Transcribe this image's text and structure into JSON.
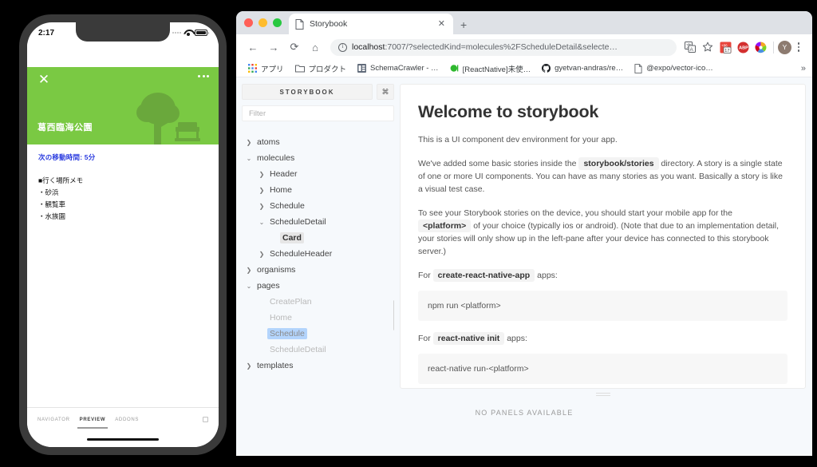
{
  "phone": {
    "status": {
      "time": "2:17",
      "signal_icon": "signal-dots-icon",
      "wifi_icon": "wifi-icon",
      "battery_icon": "battery-icon"
    },
    "card": {
      "close_icon": "close-icon",
      "more_icon": "more-horizontal-icon",
      "title": "葛西臨海公園",
      "art_icon": "park-tree-bench-icon",
      "bg_color": "#7ac943"
    },
    "detail": {
      "next_move": "次の移動時間: 5分",
      "next_move_color": "#2a3bdf",
      "memo_heading": "■行く場所メモ",
      "memo_items": [
        "・砂浜",
        "・観覧車",
        "・水族園"
      ]
    },
    "tabbar": {
      "tabs": [
        {
          "label": "NAVIGATOR",
          "active": false
        },
        {
          "label": "PREVIEW",
          "active": true
        },
        {
          "label": "ADDONS",
          "active": false
        }
      ],
      "addon_toggle_icon": "square-outline-icon"
    }
  },
  "browser": {
    "window_controls": {
      "close": "close-traffic-light",
      "minimize": "minimize-traffic-light",
      "zoom": "zoom-traffic-light"
    },
    "tab": {
      "title": "Storybook",
      "favicon": "page-icon",
      "close_label": "✕"
    },
    "new_tab_label": "+",
    "toolbar": {
      "back_label": "←",
      "forward_label": "→",
      "reload_label": "⟳",
      "home_label": "⌂",
      "url_host": "localhost",
      "url_rest": ":7007/?selectedKind=molecules%2FScheduleDetail&selecte…",
      "translate_icon": "translate-icon",
      "bookmark_icon": "star-icon",
      "extensions": [
        "calendar-extension-icon",
        "adblock-plus-icon",
        "color-wheel-extension-icon"
      ],
      "avatar_initial": "Y",
      "menu_icon": "kebab-menu-icon"
    },
    "bookmarks": [
      {
        "label": "アプリ",
        "icon": "apps-grid-icon"
      },
      {
        "label": "プロダクト",
        "icon": "folder-icon"
      },
      {
        "label": "SchemaCrawler - …",
        "icon": "schemacrawler-icon"
      },
      {
        "label": "[ReactNative]未使…",
        "icon": "green-dot-icon"
      },
      {
        "label": "gyetvan-andras/re…",
        "icon": "github-icon"
      },
      {
        "label": "@expo/vector-ico…",
        "icon": "page-icon"
      }
    ],
    "bookmarks_overflow_label": "»"
  },
  "storybook": {
    "brand": "STORYBOOK",
    "shortcut_icon": "command-key-icon",
    "filter_placeholder": "Filter",
    "tree": [
      {
        "label": "atoms",
        "depth": 0,
        "caret": "collapsed",
        "state": "normal"
      },
      {
        "label": "molecules",
        "depth": 0,
        "caret": "expanded",
        "state": "normal"
      },
      {
        "label": "Header",
        "depth": 1,
        "caret": "collapsed",
        "state": "normal"
      },
      {
        "label": "Home",
        "depth": 1,
        "caret": "collapsed",
        "state": "normal"
      },
      {
        "label": "Schedule",
        "depth": 1,
        "caret": "collapsed",
        "state": "normal"
      },
      {
        "label": "ScheduleDetail",
        "depth": 1,
        "caret": "expanded",
        "state": "normal"
      },
      {
        "label": "Card",
        "depth": 2,
        "caret": "none",
        "state": "selected"
      },
      {
        "label": "ScheduleHeader",
        "depth": 1,
        "caret": "collapsed",
        "state": "normal"
      },
      {
        "label": "organisms",
        "depth": 0,
        "caret": "collapsed",
        "state": "normal"
      },
      {
        "label": "pages",
        "depth": 0,
        "caret": "expanded",
        "state": "normal"
      },
      {
        "label": "CreatePlan",
        "depth": 1,
        "caret": "none",
        "state": "dim"
      },
      {
        "label": "Home",
        "depth": 1,
        "caret": "none",
        "state": "dim"
      },
      {
        "label": "Schedule",
        "depth": 1,
        "caret": "none",
        "state": "highlighted"
      },
      {
        "label": "ScheduleDetail",
        "depth": 1,
        "caret": "none",
        "state": "dim"
      },
      {
        "label": "templates",
        "depth": 0,
        "caret": "collapsed",
        "state": "normal"
      }
    ],
    "doc": {
      "title": "Welcome to storybook",
      "p1": "This is a UI component dev environment for your app.",
      "p2_a": "We've added some basic stories inside the",
      "p2_code": "storybook/stories",
      "p2_b": "directory. A story is a single state of one or more UI components. You can have as many stories as you want. Basically a story is like a visual test case.",
      "p3_a": "To see your Storybook stories on the device, you should start your mobile app for the",
      "p3_code": "<platform>",
      "p3_b": "of your choice (typically ios or android). (Note that due to an implementation detail, your stories will only show up in the left-pane after your device has connected to this storybook server.)",
      "p4_a": "For",
      "p4_code": "create-react-native-app",
      "p4_b": "apps:",
      "block1": "npm run <platform>",
      "p5_a": "For",
      "p5_code": "react-native init",
      "p5_b": "apps:",
      "block2": "react-native run-<platform>"
    },
    "panel": {
      "empty_label": "NO PANELS AVAILABLE",
      "resizer_icon": "drag-handle-icon"
    }
  }
}
